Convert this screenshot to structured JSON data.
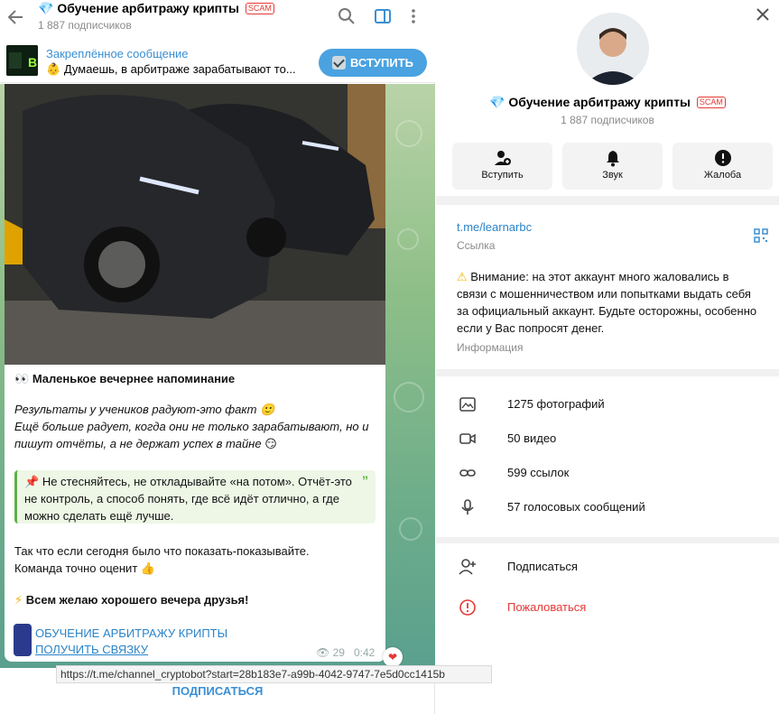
{
  "channel": {
    "title": "Обучение арбитражу крипты",
    "scam_badge": "SCAM",
    "subscribers": "1 887 подписчиков"
  },
  "pinned": {
    "title": "Закреплённое сообщение",
    "text": "Думаешь, в арбитраже зарабатывают то..."
  },
  "join_button": "ВСТУПИТЬ",
  "post": {
    "heading": "Маленькое вечернее напоминание",
    "italic_1": "Результаты у учеников радуют-это факт",
    "italic_2": "Ещё больше радует, когда они не только зарабатывают, но и",
    "italic_3": "пишут отчёты, а не держат успех в тайне",
    "quote_1": "Не стесняйтесь, не откладывайте «на потом». Отчёт-это",
    "quote_2": "не контроль, а способ понять, где всё идёт отлично, а где",
    "quote_3": "можно сделать ещё лучше.",
    "para_1": "Так что если сегодня было что показать-показывайте.",
    "para_2": "Команда точно оценит",
    "closing": "Всем желаю хорошего вечера друзья!",
    "link_1": "ОБУЧЕНИЕ АРБИТРАЖУ КРИПТЫ",
    "link_2": "ПОЛУЧИТЬ СВЯЗКУ",
    "views": "29",
    "time": "0:42"
  },
  "tooltip_url": "https://t.me/channel_cryptobot?start=28b183e7-a99b-4042-9747-7e5d0cc1415b",
  "subscribe_bottom": "ПОДПИСАТЬСЯ",
  "info": {
    "actions": {
      "join": "Вступить",
      "sound": "Звук",
      "report": "Жалоба"
    },
    "link": "t.me/learnarbc",
    "link_label": "Ссылка",
    "warning_1": "Внимание: на этот аккаунт много жаловались в",
    "warning_2": "связи с мошенничеством или попытками выдать себя",
    "warning_3": "за официальный аккаунт. Будьте осторожны, особенно",
    "warning_4": "если у Вас попросят денег.",
    "warning_label": "Информация",
    "media": {
      "photos": "1275 фотографий",
      "videos": "50 видео",
      "links": "599 ссылок",
      "voice": "57 голосовых сообщений"
    },
    "subscribe": "Подписаться",
    "report": "Пожаловаться"
  },
  "colors": {
    "accent": "#3a8fd4",
    "danger": "#e53935",
    "scam": "#e53935"
  }
}
